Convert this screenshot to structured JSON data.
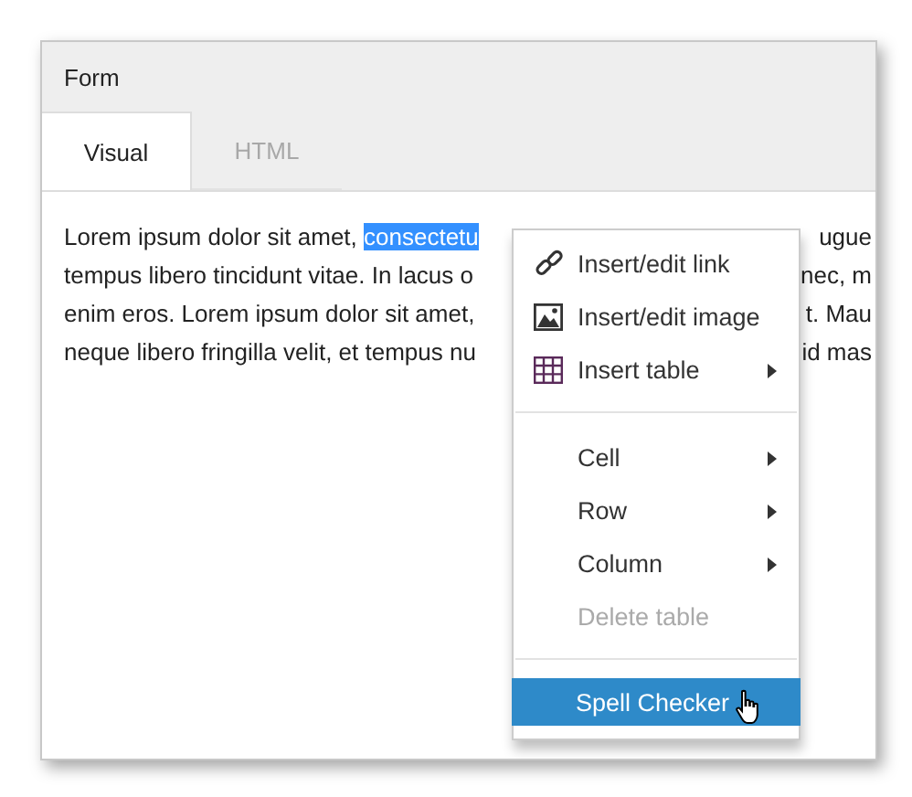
{
  "window": {
    "title": "Form"
  },
  "tabs": [
    {
      "label": "Visual",
      "selected": true
    },
    {
      "label": "HTML",
      "selected": false
    }
  ],
  "editor": {
    "lines": [
      {
        "left": "Lorem ipsum dolor sit amet, ",
        "selection": "consectetu",
        "right": "ugue"
      },
      {
        "left": "tempus libero tincidunt vitae. In lacus o",
        "right": "nec, m"
      },
      {
        "left": "enim eros. Lorem ipsum dolor sit amet,",
        "right": "t. Mau"
      },
      {
        "left": "neque libero fringilla velit, et tempus nu",
        "right": "id mas"
      }
    ]
  },
  "context_menu": {
    "groups": [
      [
        {
          "label": "Insert/edit link",
          "kind": "link",
          "submenu": false,
          "disabled": false,
          "selected": false
        },
        {
          "label": "Insert/edit image",
          "kind": "image",
          "submenu": false,
          "disabled": false,
          "selected": false
        },
        {
          "label": "Insert table",
          "kind": "table",
          "submenu": true,
          "disabled": false,
          "selected": false
        }
      ],
      [
        {
          "label": "Cell",
          "submenu": true,
          "disabled": false,
          "selected": false
        },
        {
          "label": "Row",
          "submenu": true,
          "disabled": false,
          "selected": false
        },
        {
          "label": "Column",
          "submenu": true,
          "disabled": false,
          "selected": false
        },
        {
          "label": "Delete table",
          "submenu": false,
          "disabled": true,
          "selected": false
        }
      ],
      [
        {
          "label": "Spell Checker",
          "submenu": false,
          "disabled": false,
          "selected": true
        }
      ]
    ]
  }
}
